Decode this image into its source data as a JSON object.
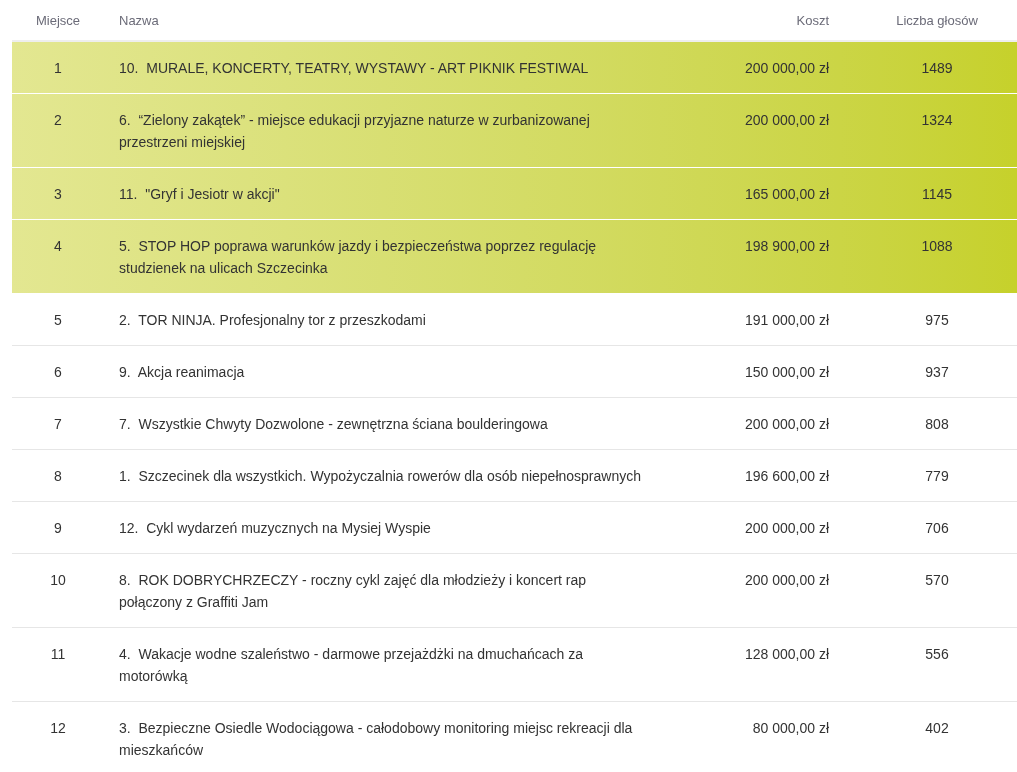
{
  "columns": [
    {
      "label": "Miejsce"
    },
    {
      "label": "Nazwa"
    },
    {
      "label": "Koszt"
    },
    {
      "label": "Liczba głosów"
    }
  ],
  "rows": [
    {
      "place": "1",
      "name": "10.  MURALE, KONCERTY, TEATRY, WYSTAWY - ART PIKNIK FESTIWAL",
      "cost": "200 000,00 zł",
      "votes": "1489",
      "funded": true
    },
    {
      "place": "2",
      "name": "6.  “Zielony zakątek” - miejsce edukacji przyjazne naturze w zurbanizowanej przestrzeni miejskiej",
      "cost": "200 000,00 zł",
      "votes": "1324",
      "funded": true
    },
    {
      "place": "3",
      "name": "11.  \"Gryf i Jesiotr w akcji\"",
      "cost": "165 000,00 zł",
      "votes": "1145",
      "funded": true
    },
    {
      "place": "4",
      "name": "5.  STOP HOP poprawa warunków jazdy i bezpieczeństwa poprzez regulację studzienek na ulicach Szczecinka",
      "cost": "198 900,00 zł",
      "votes": "1088",
      "funded": true
    },
    {
      "place": "5",
      "name": "2.  TOR NINJA. Profesjonalny tor z przeszkodami",
      "cost": "191 000,00 zł",
      "votes": "975",
      "funded": false
    },
    {
      "place": "6",
      "name": "9.  Akcja reanimacja",
      "cost": "150 000,00 zł",
      "votes": "937",
      "funded": false
    },
    {
      "place": "7",
      "name": "7.  Wszystkie Chwyty Dozwolone - zewnętrzna ściana boulderingowa",
      "cost": "200 000,00 zł",
      "votes": "808",
      "funded": false
    },
    {
      "place": "8",
      "name": "1.  Szczecinek dla wszystkich. Wypożyczalnia rowerów dla osób niepełnosprawnych",
      "cost": "196 600,00 zł",
      "votes": "779",
      "funded": false
    },
    {
      "place": "9",
      "name": "12.  Cykl wydarzeń muzycznych na Mysiej Wyspie",
      "cost": "200 000,00 zł",
      "votes": "706",
      "funded": false
    },
    {
      "place": "10",
      "name": "8.  ROK DOBRYCHRZECZY - roczny cykl zajęć dla młodzieży i koncert rap połączony z Graffiti Jam",
      "cost": "200 000,00 zł",
      "votes": "570",
      "funded": false
    },
    {
      "place": "11",
      "name": "4.  Wakacje wodne szaleństwo - darmowe przejażdżki na dmuchańcach za motorówką",
      "cost": "128 000,00 zł",
      "votes": "556",
      "funded": false
    },
    {
      "place": "12",
      "name": "3.  Bezpieczne Osiedle Wodociągowa - całodobowy monitoring miejsc rekreacji dla mieszkańców",
      "cost": "80 000,00 zł",
      "votes": "402",
      "funded": false
    }
  ]
}
